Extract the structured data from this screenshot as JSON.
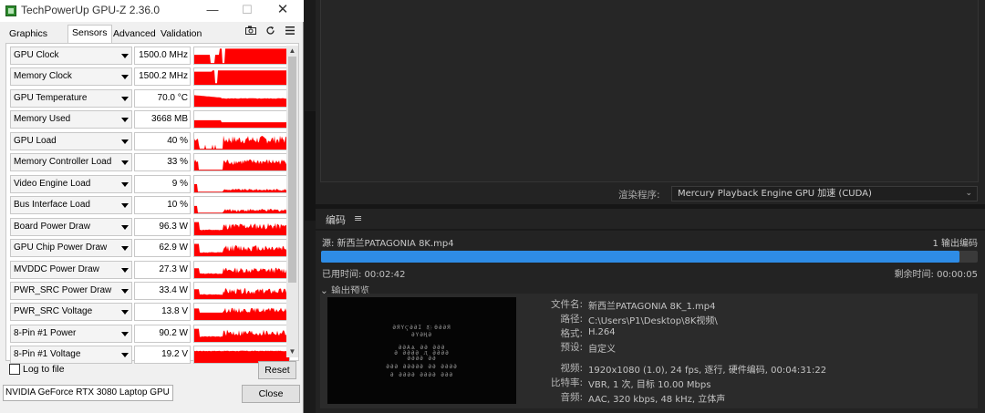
{
  "gpuz": {
    "title": "TechPowerUp GPU-Z 2.36.0",
    "window_buttons": {
      "minimize": "—",
      "maximize": "☐",
      "close": "✕"
    },
    "tabs": [
      "Graphics Card",
      "Sensors",
      "Advanced",
      "Validation"
    ],
    "active_tab": "Sensors",
    "toolbar_icons": [
      "camera-icon",
      "refresh-icon",
      "menu-icon"
    ],
    "sensors": [
      {
        "label": "GPU Clock",
        "value": "1500.0 MHz",
        "pattern": "clock"
      },
      {
        "label": "Memory Clock",
        "value": "1500.2 MHz",
        "pattern": "clock2"
      },
      {
        "label": "GPU Temperature",
        "value": "70.0 °C",
        "pattern": "temp"
      },
      {
        "label": "Memory Used",
        "value": "3668 MB",
        "pattern": "mem"
      },
      {
        "label": "GPU Load",
        "value": "40 %",
        "pattern": "load"
      },
      {
        "label": "Memory Controller Load",
        "value": "33 %",
        "pattern": "load2"
      },
      {
        "label": "Video Engine Load",
        "value": "9 %",
        "pattern": "low"
      },
      {
        "label": "Bus Interface Load",
        "value": "10 %",
        "pattern": "low2"
      },
      {
        "label": "Board Power Draw",
        "value": "96.3 W",
        "pattern": "power"
      },
      {
        "label": "GPU Chip Power Draw",
        "value": "62.9 W",
        "pattern": "power2"
      },
      {
        "label": "MVDDC Power Draw",
        "value": "27.3 W",
        "pattern": "power3"
      },
      {
        "label": "PWR_SRC Power Draw",
        "value": "33.4 W",
        "pattern": "power3"
      },
      {
        "label": "PWR_SRC Voltage",
        "value": "13.8 V",
        "pattern": "volt"
      },
      {
        "label": "8-Pin #1 Power",
        "value": "90.2 W",
        "pattern": "power"
      },
      {
        "label": "8-Pin #1 Voltage",
        "value": "19.2 V",
        "pattern": "volt2"
      }
    ],
    "scroll_up": "▲",
    "scroll_down": "▼",
    "log_to_file": "Log to file",
    "reset": "Reset",
    "gpu_select": "NVIDIA GeForce RTX 3080 Laptop GPU",
    "close": "Close",
    "graph_color": "#ff0000"
  },
  "encoder": {
    "renderer_label": "渲染程序:",
    "renderer_value": "Mercury Playback Engine GPU 加速 (CUDA)",
    "header": "编码",
    "menu_icon": "≡",
    "source": "源: 新西兰PATAGONIA 8K.mp4",
    "queue_count": "1 输出编码",
    "progress": 0.972,
    "progress_color": "#2e8ce6",
    "elapsed": "已用时间: 00:02:42",
    "remaining": "剩余时间: 00:00:05",
    "output_preview": "⌄ 输出预览",
    "preview_lines": [
      "ӘЯҮҀӘӘΙ Ӡ҈ ӨӘӘЯ",
      "ӘҮӘҢӘ",
      "ӘӘΑѦ ӘӘ ӘӘӘ",
      "Ә ӘӘӘӘ Ӆ ӘӘӘӘ",
      "ӘӘӘӘ ӘӘ",
      "ӘӘӘ ӘӘӘӘӘ ӘӘ ӘӘӘӘ",
      "Ә ӘӘӘӘ ӘӘӘӘ ӘӘӘ"
    ],
    "info": [
      {
        "label": "文件名:",
        "value": "新西兰PATAGONIA 8K_1.mp4"
      },
      {
        "label": "路径:",
        "value": "C:\\Users\\P1\\Desktop\\8K视频\\"
      },
      {
        "label": "格式:",
        "value": "H.264"
      },
      {
        "label": "预设:",
        "value": "自定义"
      },
      {
        "label": "视频:",
        "value": "1920x1080 (1.0), 24 fps, 逐行, 硬件编码, 00:04:31:22"
      },
      {
        "label": "比特率:",
        "value": "VBR, 1 次, 目标 10.00 Mbps"
      },
      {
        "label": "音频:",
        "value": "AAC, 320 kbps, 48 kHz, 立体声"
      }
    ]
  }
}
